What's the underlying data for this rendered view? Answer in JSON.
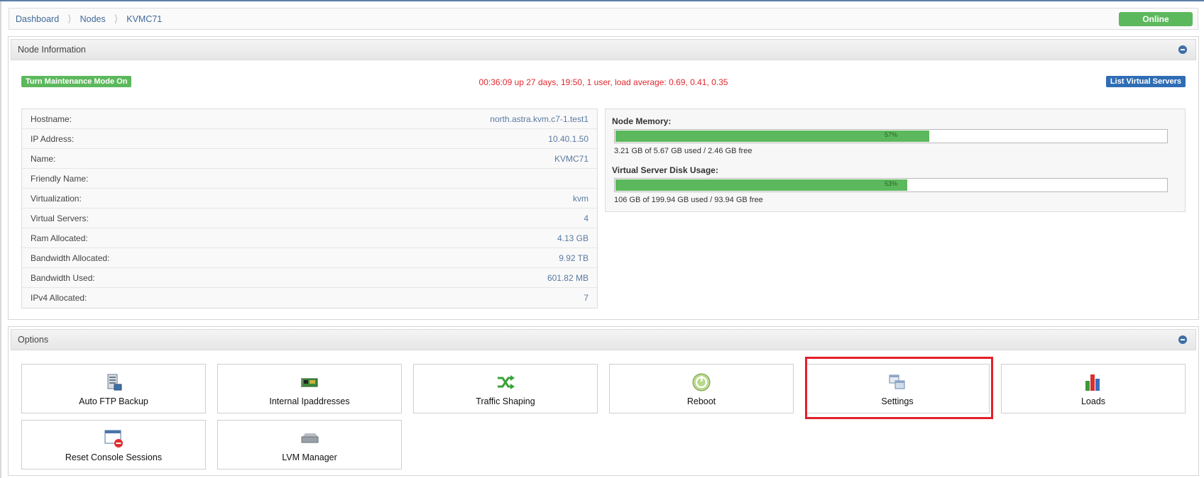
{
  "breadcrumb": {
    "items": [
      "Dashboard",
      "Nodes",
      "KVMC71"
    ],
    "status": "Online"
  },
  "node_panel": {
    "title": "Node Information",
    "maintenance_button": "Turn Maintenance Mode On",
    "uptime": "00:36:09 up 27 days, 19:50, 1 user, load average: 0.69, 0.41, 0.35",
    "list_button": "List Virtual Servers",
    "info": [
      {
        "label": "Hostname:",
        "value": "north.astra.kvm.c7-1.test1"
      },
      {
        "label": "IP Address:",
        "value": "10.40.1.50"
      },
      {
        "label": "Name:",
        "value": "KVMC71"
      },
      {
        "label": "Friendly Name:",
        "value": ""
      },
      {
        "label": "Virtualization:",
        "value": "kvm"
      },
      {
        "label": "Virtual Servers:",
        "value": "4"
      },
      {
        "label": "Ram Allocated:",
        "value": "4.13 GB"
      },
      {
        "label": "Bandwidth Allocated:",
        "value": "9.92 TB"
      },
      {
        "label": "Bandwidth Used:",
        "value": "601.82 MB"
      },
      {
        "label": "IPv4 Allocated:",
        "value": "7"
      }
    ],
    "memory": {
      "title": "Node Memory:",
      "percent_label": "57%",
      "percent": 57,
      "note": "3.21 GB of 5.67 GB used / 2.46 GB free"
    },
    "disk": {
      "title": "Virtual Server Disk Usage:",
      "percent_label": "53%",
      "percent": 53,
      "note": "106 GB of 199.94 GB used / 93.94 GB free"
    }
  },
  "options_panel": {
    "title": "Options",
    "items": [
      {
        "label": "Auto FTP Backup",
        "icon": "server-backup-icon"
      },
      {
        "label": "Internal Ipaddresses",
        "icon": "network-card-icon"
      },
      {
        "label": "Traffic Shaping",
        "icon": "shuffle-arrows-icon"
      },
      {
        "label": "Reboot",
        "icon": "reboot-icon"
      },
      {
        "label": "Settings",
        "icon": "windows-settings-icon"
      },
      {
        "label": "Loads",
        "icon": "bar-chart-icon"
      },
      {
        "label": "Reset Console Sessions",
        "icon": "console-reset-icon"
      },
      {
        "label": "LVM Manager",
        "icon": "disk-drive-icon"
      }
    ]
  },
  "colors": {
    "accent": "#3f6a9a",
    "success": "#5cb85c",
    "danger": "#e0282e",
    "highlight": "#e2202a"
  }
}
